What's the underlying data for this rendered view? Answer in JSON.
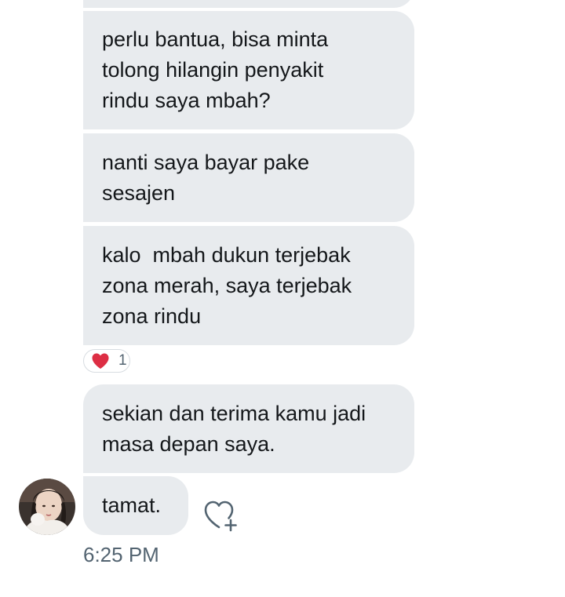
{
  "messages": [
    {
      "text": ""
    },
    {
      "text": "perlu bantua, bisa minta\ntolong hilangin penyakit\nrindu saya mbah?"
    },
    {
      "text": "nanti saya bayar pake\nsesajen"
    },
    {
      "text": "kalo  mbah dukun terjebak\nzona merah, saya terjebak\nzona rindu"
    },
    {
      "text": "sekian dan terima kamu jadi\nmasa depan saya."
    },
    {
      "text": "tamat."
    }
  ],
  "reaction": {
    "icon": "red-heart-icon",
    "count": "1"
  },
  "like_button_icon": "heart-plus-icon",
  "avatar_icon": "user-avatar",
  "timestamp": "6:25 PM",
  "colors": {
    "bubble": "#e8ebee",
    "text": "#14171a",
    "muted": "#536471",
    "heart": "#e0245e"
  }
}
